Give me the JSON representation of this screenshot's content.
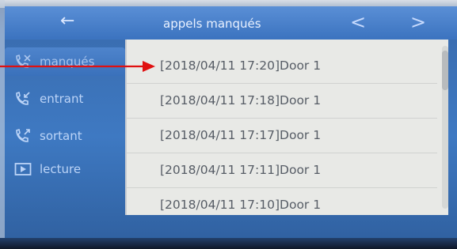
{
  "header": {
    "title": "appels manqués",
    "back_icon": "←",
    "prev_icon": "<",
    "next_icon": ">"
  },
  "sidebar": {
    "items": [
      {
        "label": "manqués",
        "icon": "missed-call-icon"
      },
      {
        "label": "entrant",
        "icon": "incoming-call-icon"
      },
      {
        "label": "sortant",
        "icon": "outgoing-call-icon"
      },
      {
        "label": "lecture",
        "icon": "play-icon"
      }
    ]
  },
  "calls": [
    "[2018/04/11 17:20]Door 1",
    "[2018/04/11 17:18]Door 1",
    "[2018/04/11 17:17]Door 1",
    "[2018/04/11 17:11]Door 1",
    "[2018/04/11 17:10]Door 1"
  ],
  "colors": {
    "accent": "#3b73bf",
    "annotation_arrow": "#e01010"
  }
}
